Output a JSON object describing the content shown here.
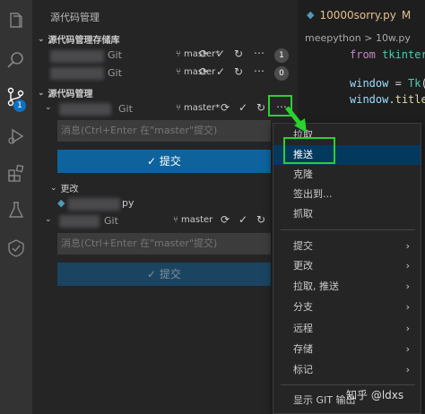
{
  "sidebar": {
    "title": "源代码管理",
    "repos_header": "源代码管理存储库",
    "scm_header": "源代码管理"
  },
  "repos": [
    {
      "git": "Git",
      "branch": "master*",
      "count": "1"
    },
    {
      "git": "Git",
      "branch": "master",
      "count": "0"
    }
  ],
  "repo1": {
    "git": "Git",
    "branch": "master*",
    "message_placeholder": "消息(Ctrl+Enter 在\"master\"提交)",
    "commit_label": "提交",
    "changes_header": "更改",
    "changed_file": "py"
  },
  "repo2": {
    "git": "Git",
    "branch": "master",
    "message_placeholder": "消息(Ctrl+Enter 在\"master\"提交)",
    "commit_label": "提交"
  },
  "editor": {
    "tab_label": "10000sorry.py",
    "tab_status": "M",
    "breadcrumb": "meepython > 10w.py",
    "lines": [
      {
        "no": "",
        "tokens": [
          [
            "kw",
            "from "
          ],
          [
            "mod",
            "tkinter "
          ],
          [
            "kw",
            "i"
          ]
        ]
      },
      {
        "no": "",
        "tokens": []
      },
      {
        "no": "",
        "tokens": [
          [
            "var",
            "window "
          ],
          [
            "plain",
            "= "
          ],
          [
            "mod",
            "Tk"
          ],
          [
            "plain",
            "()"
          ]
        ]
      },
      {
        "no": "",
        "tokens": [
          [
            "var",
            "window"
          ],
          [
            "plain",
            "."
          ],
          [
            "fn",
            "title"
          ],
          [
            "plain",
            "("
          ]
        ]
      }
    ]
  },
  "menu": {
    "items": [
      "拉取",
      "推送",
      "克隆",
      "签出到...",
      "抓取"
    ],
    "submenus": [
      "提交",
      "更改",
      "拉取, 推送",
      "分支",
      "远程",
      "存储",
      "标记"
    ],
    "bottom": "显示 GIT 输出"
  },
  "activity_badge": "1",
  "watermark": "知乎 @ldxs",
  "colors": {
    "accent": "#0e639c",
    "highlight_box": "#2bd12e"
  }
}
